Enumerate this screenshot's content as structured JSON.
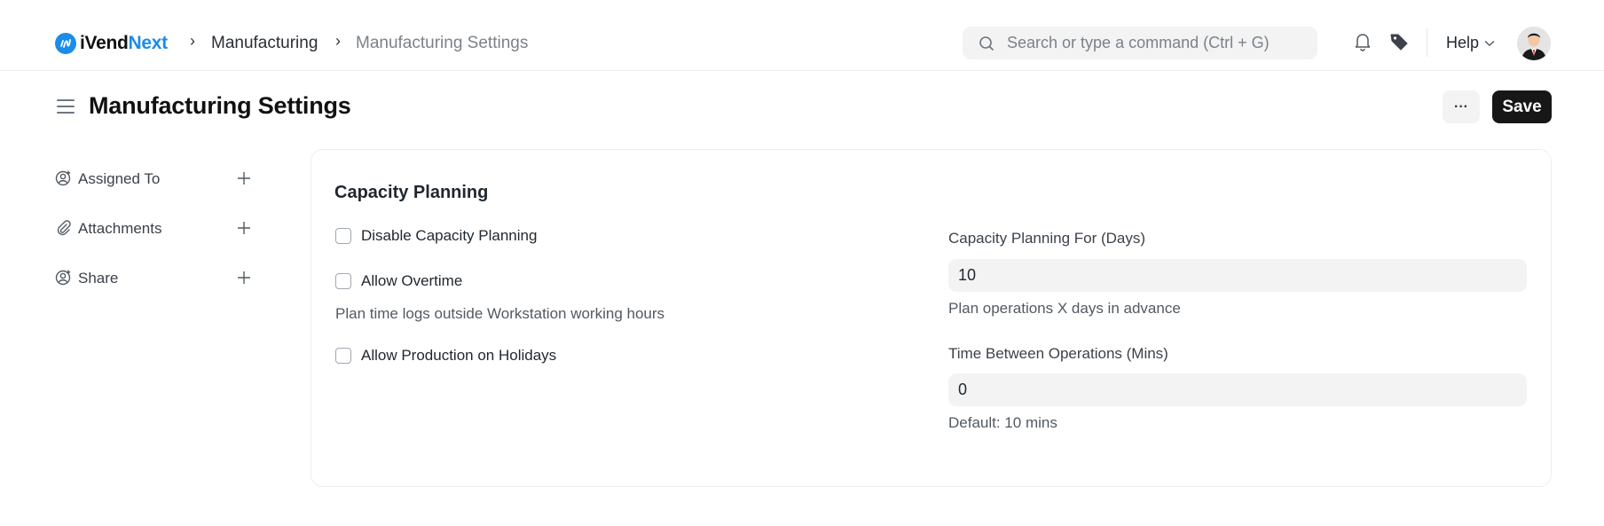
{
  "navbar": {
    "brand": {
      "name_primary": "iVend",
      "name_accent": "Next",
      "accent_color": "#1c8ce8"
    },
    "breadcrumbs": [
      {
        "label": "Manufacturing"
      },
      {
        "label": "Manufacturing Settings"
      }
    ],
    "search": {
      "placeholder": "Search or type a command (Ctrl + G)",
      "value": ""
    },
    "icons": [
      "bell-icon",
      "tag-icon"
    ],
    "help_label": "Help"
  },
  "page": {
    "title": "Manufacturing Settings",
    "more_label": "···",
    "save_label": "Save"
  },
  "sidebar": {
    "items": [
      {
        "label": "Assigned To",
        "icon": "assign-user-icon"
      },
      {
        "label": "Attachments",
        "icon": "paperclip-icon"
      },
      {
        "label": "Share",
        "icon": "share-user-icon"
      }
    ]
  },
  "form": {
    "section_title": "Capacity Planning",
    "checkboxes": [
      {
        "label": "Disable Capacity Planning",
        "checked": false
      },
      {
        "label": "Allow Overtime",
        "checked": false,
        "description": "Plan time logs outside Workstation working hours"
      },
      {
        "label": "Allow Production on Holidays",
        "checked": false
      }
    ],
    "fields": [
      {
        "label": "Capacity Planning For (Days)",
        "value": "10",
        "description": "Plan operations X days in advance"
      },
      {
        "label": "Time Between Operations (Mins)",
        "value": "0",
        "description": "Default: 10 mins"
      }
    ]
  }
}
